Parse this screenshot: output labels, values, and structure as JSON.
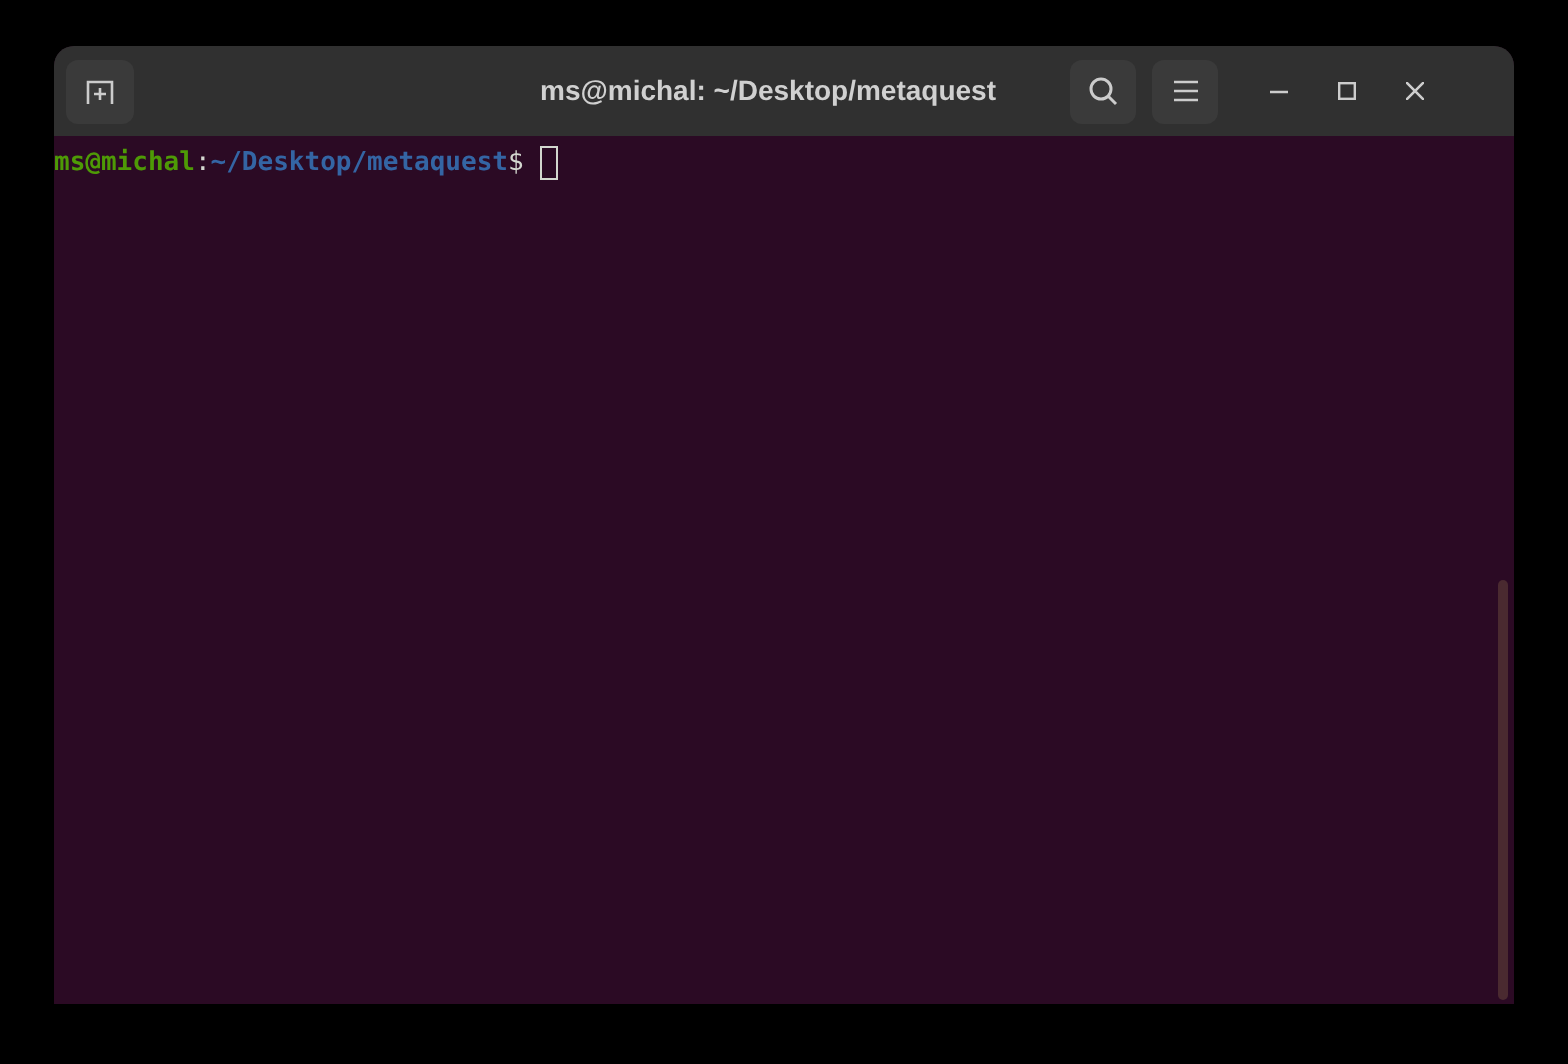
{
  "window": {
    "title": "ms@michal: ~/Desktop/metaquest"
  },
  "prompt": [
    {
      "kind": "user",
      "text": "ms@michal"
    },
    {
      "kind": "plain",
      "text": ":"
    },
    {
      "kind": "path",
      "text": "~/Desktop/metaquest"
    },
    {
      "kind": "plain",
      "text": "$"
    }
  ]
}
